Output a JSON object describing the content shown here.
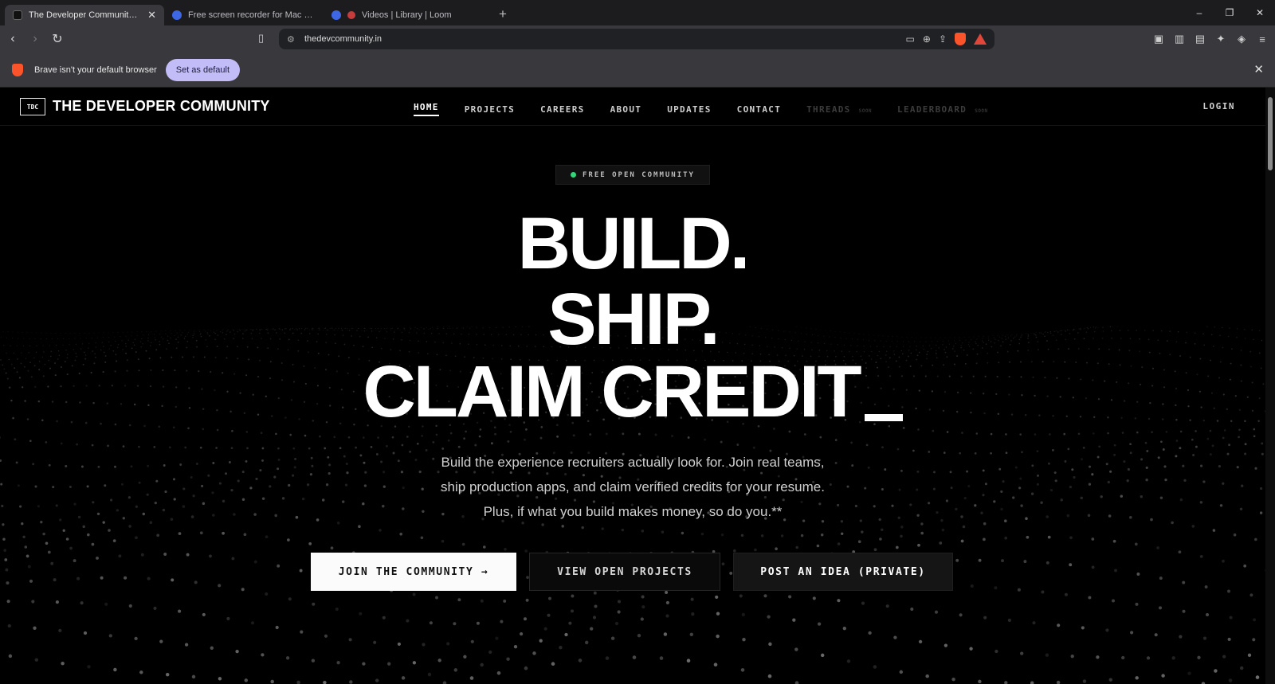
{
  "browser": {
    "tabs": [
      {
        "title": "The Developer Community — Br",
        "active": true
      },
      {
        "title": "Free screen recorder for Mac and PC",
        "active": false
      },
      {
        "title": "Videos | Library | Loom",
        "active": false
      }
    ],
    "new_tab": "+",
    "window_controls": {
      "minimize": "–",
      "maximize": "❐",
      "close": "✕"
    },
    "url": "thedevcommunity.in",
    "infobar": {
      "message": "Brave isn't your default browser",
      "button": "Set as default",
      "close": "✕"
    }
  },
  "site": {
    "logo_mark": "TDC",
    "logo_text": "THE DEVELOPER COMMUNITY",
    "nav": [
      {
        "label": "HOME",
        "active": true
      },
      {
        "label": "PROJECTS"
      },
      {
        "label": "CAREERS"
      },
      {
        "label": "ABOUT"
      },
      {
        "label": "UPDATES"
      },
      {
        "label": "CONTACT"
      },
      {
        "label": "THREADS",
        "tag": "SOON"
      },
      {
        "label": "LEADERBOARD",
        "tag": "SOON"
      }
    ],
    "login": "LOGIN"
  },
  "hero": {
    "badge": "FREE OPEN COMMUNITY",
    "line1": "BUILD.",
    "line2": "SHIP.",
    "line3": "CLAIM CREDIT",
    "subtitle_lines": [
      "Build the experience recruiters actually look for. Join real teams,",
      "ship production apps, and claim verified credits for your resume.",
      "Plus, if what you build makes money, so do you.**"
    ],
    "buttons": {
      "join": "JOIN THE COMMUNITY →",
      "view": "VIEW OPEN PROJECTS",
      "post": "POST AN IDEA (PRIVATE)"
    }
  },
  "colors": {
    "page_bg": "#000000",
    "accent_green": "#34d67b",
    "set_default_bg": "#c3bdf7",
    "chrome_bg": "#38383d"
  }
}
